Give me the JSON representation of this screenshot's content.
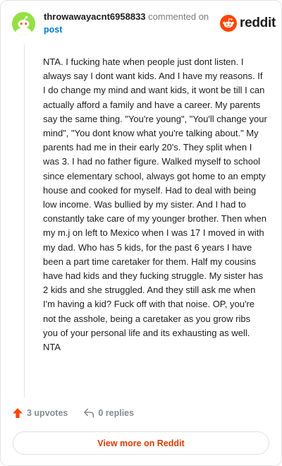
{
  "comment": {
    "username": "throwawayacnt6958833",
    "action_text": "commented on",
    "post_link": "post",
    "body": "NTA. I fucking hate when people just dont listen. I always say I dont want kids. And I have my reasons. If I do change my mind and want kids, it wont be till I can actually afford a family and have a career. My parents say the same thing. \"You're young\", \"You'll change your mind\", \"You dont know what you're talking about.\" My parents had me in their early 20's. They split when I was 3. I had no father figure. Walked myself to school since elementary school, always got home to an empty house and cooked for myself. Had to deal with being low income. Was bullied by my sister. And I had to constantly take care of my younger brother. Then when my m.j on left to Mexico when I was 17 I moved in with my dad. Who has 5 kids, for the past 6 years I have been a part time caretaker for them. Half my cousins have had kids and they fucking struggle. My sister has 2 kids and she struggled. And they still ask me when I'm having a kid? Fuck off with that noise. OP, you're not the asshole, being a caretaker as you grow ribs you of your personal life and its exhausting as well. NTA",
    "upvotes_label": "3 upvotes",
    "replies_label": "0 replies"
  },
  "brand": {
    "wordmark": "reddit",
    "icon": "reddit-snoo-icon"
  },
  "footer": {
    "view_more_label": "View more on Reddit"
  },
  "colors": {
    "avatar_bg": "#94e044",
    "link": "#0079d3",
    "upvote": "#ff4500",
    "brand": "#ff4500",
    "view_more_text": "#d93a00",
    "muted": "#878a8c"
  }
}
